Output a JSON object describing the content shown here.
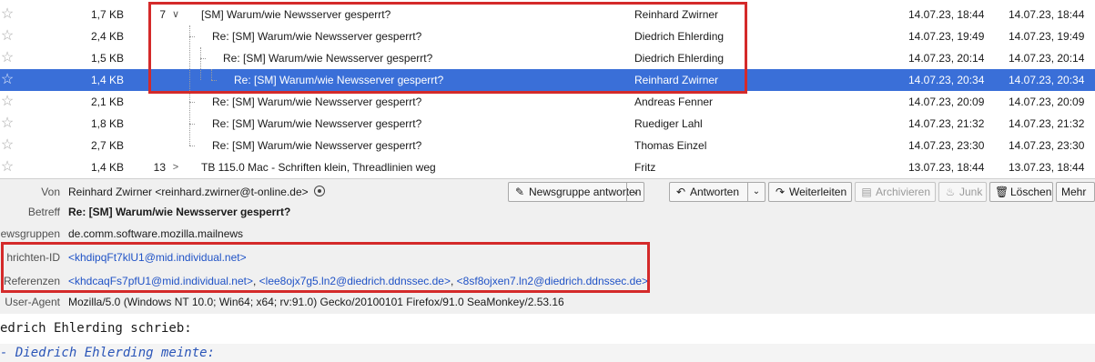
{
  "thread_list": {
    "rows": [
      {
        "size": "1,7 KB",
        "count": "7",
        "twisty": "∨",
        "subject": "[SM] Warum/wie Newsserver gesperrt?",
        "author": "Reinhard Zwirner",
        "date": "14.07.23, 18:44",
        "received": "14.07.23, 18:44"
      },
      {
        "size": "2,4 KB",
        "count": "",
        "twisty": "",
        "subject": "Re: [SM] Warum/wie Newsserver gesperrt?",
        "author": "Diedrich Ehlerding",
        "date": "14.07.23, 19:49",
        "received": "14.07.23, 19:49"
      },
      {
        "size": "1,5 KB",
        "count": "",
        "twisty": "",
        "subject": "Re: [SM] Warum/wie Newsserver gesperrt?",
        "author": "Diedrich Ehlerding",
        "date": "14.07.23, 20:14",
        "received": "14.07.23, 20:14"
      },
      {
        "size": "1,4 KB",
        "count": "",
        "twisty": "",
        "subject": "Re: [SM] Warum/wie Newsserver gesperrt?",
        "author": "Reinhard Zwirner",
        "date": "14.07.23, 20:34",
        "received": "14.07.23, 20:34"
      },
      {
        "size": "2,1 KB",
        "count": "",
        "twisty": "",
        "subject": "Re: [SM] Warum/wie Newsserver gesperrt?",
        "author": "Andreas Fenner",
        "date": "14.07.23, 20:09",
        "received": "14.07.23, 20:09"
      },
      {
        "size": "1,8 KB",
        "count": "",
        "twisty": "",
        "subject": "Re: [SM] Warum/wie Newsserver gesperrt?",
        "author": "Ruediger Lahl",
        "date": "14.07.23, 21:32",
        "received": "14.07.23, 21:32"
      },
      {
        "size": "2,7 KB",
        "count": "",
        "twisty": "",
        "subject": "Re: [SM] Warum/wie Newsserver gesperrt?",
        "author": "Thomas Einzel",
        "date": "14.07.23, 23:30",
        "received": "14.07.23, 23:30"
      },
      {
        "size": "1,4 KB",
        "count": "13",
        "twisty": ">",
        "subject": "TB 115.0 Mac - Schriften klein, Threadlinien weg",
        "author": "Fritz",
        "date": "13.07.23, 18:44",
        "received": "13.07.23, 18:44"
      }
    ]
  },
  "header": {
    "from_label": "Von",
    "from_value": "Reinhard Zwirner <reinhard.zwirner@t-online.de>",
    "subject_label": "Betreff",
    "subject_value": "Re: [SM] Warum/wie Newsserver gesperrt?",
    "newsgroups_label": "ewsgruppen",
    "newsgroups_value": "de.comm.software.mozilla.mailnews",
    "messageid_label": "hrichten-ID",
    "messageid_value": "<khdipqFt7klU1@mid.individual.net>",
    "references_label": "Referenzen",
    "references": [
      "<khdcaqFs7pfU1@mid.individual.net>",
      "<lee8ojx7g5.ln2@diedrich.ddnssec.de>",
      "<8sf8ojxen7.ln2@diedrich.ddnssec.de>"
    ],
    "reference_separator": ",",
    "useragent_label": "User-Agent",
    "useragent_value": "Mozilla/5.0 (Windows NT 10.0; Win64; x64; rv:91.0) Gecko/20100101 Firefox/91.0 SeaMonkey/2.53.16"
  },
  "toolbar": {
    "reply_newsgroup": "Newsgruppe antworten",
    "reply": "Antworten",
    "forward": "Weiterleiten",
    "archive": "Archivieren",
    "junk": "Junk",
    "delete": "Löschen",
    "more": "Mehr"
  },
  "body": {
    "line1": "edrich Ehlerding schrieb:",
    "line2": "Diedrich Ehlerding meinte:"
  },
  "colors": {
    "selection": "#3a6fd8",
    "link": "#1f52c6",
    "highlight_box": "#d42a2a"
  },
  "icons": {
    "star": "star-icon",
    "security": "security-icon",
    "reply_newsgroup": "reply-newsgroup-icon",
    "reply": "reply-icon",
    "forward": "forward-icon",
    "archive": "archive-icon",
    "junk": "junk-icon",
    "delete": "trash-icon"
  }
}
